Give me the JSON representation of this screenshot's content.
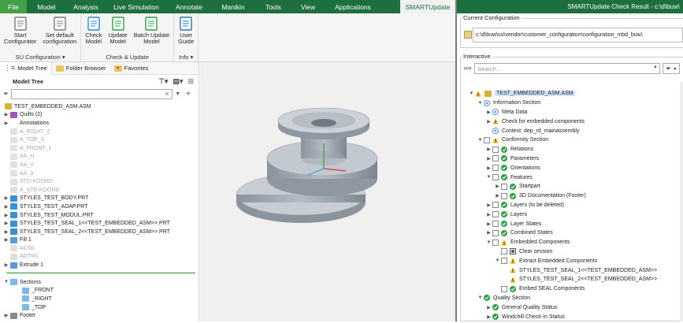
{
  "menubar": {
    "tabs": [
      "File",
      "Model",
      "Analysis",
      "Live Simulation",
      "Annotate",
      "Manikin",
      "Tools",
      "View",
      "Applications",
      "SMARTUpdate"
    ]
  },
  "ribbon": {
    "groups": [
      {
        "name": "SU Configuration ▾",
        "buttons": [
          "Start\nConfigurator",
          "Set default\nconfiguration"
        ]
      },
      {
        "name": "Check & Update",
        "buttons": [
          "Check\nModel",
          "Update\nModel",
          "Batch Update\nModel"
        ]
      },
      {
        "name": "Info ▾",
        "buttons": [
          "User\nGuide"
        ]
      }
    ]
  },
  "navtabs": [
    "Model Tree",
    "Folder Browser",
    "Favorites"
  ],
  "model_tree": {
    "header": "Model Tree",
    "items": [
      {
        "label": "TEST_EMBEDDED_ASM.ASM",
        "indent": 0,
        "arrow": "",
        "icon": "asm",
        "grey": false
      },
      {
        "label": "Quilts (2)",
        "indent": 1,
        "arrow": "▶",
        "icon": "quilt",
        "grey": false
      },
      {
        "label": "Annotations",
        "indent": 1,
        "arrow": "▶",
        "icon": "none",
        "grey": false
      },
      {
        "label": "A_RIGHT_2",
        "indent": 1,
        "arrow": "",
        "icon": "plane",
        "grey": true
      },
      {
        "label": "A_TOP_3",
        "indent": 1,
        "arrow": "",
        "icon": "plane",
        "grey": true
      },
      {
        "label": "A_FRONT_1",
        "indent": 1,
        "arrow": "",
        "icon": "plane",
        "grey": true
      },
      {
        "label": "AA_H",
        "indent": 1,
        "arrow": "",
        "icon": "axis",
        "grey": true
      },
      {
        "label": "AA_V",
        "indent": 1,
        "arrow": "",
        "icon": "axis",
        "grey": true
      },
      {
        "label": "AA_3",
        "indent": 1,
        "arrow": "",
        "icon": "axis",
        "grey": true
      },
      {
        "label": "STD-KOORD",
        "indent": 1,
        "arrow": "",
        "icon": "csys",
        "grey": true
      },
      {
        "label": "A_STD-KOORD",
        "indent": 1,
        "arrow": "",
        "icon": "csys",
        "grey": true
      },
      {
        "label": "STYLES_TEST_BODY.PRT",
        "indent": 1,
        "arrow": "▶",
        "icon": "part",
        "grey": false
      },
      {
        "label": "STYLES_TEST_ADAP.PRT",
        "indent": 1,
        "arrow": "▶",
        "icon": "part",
        "grey": false
      },
      {
        "label": "STYLES_TEST_MODUL.PRT",
        "indent": 1,
        "arrow": "▶",
        "icon": "part",
        "grey": false
      },
      {
        "label": "STYLES_TEST_SEAL_1<<TEST_EMBEDDED_ASM>>.PRT",
        "indent": 1,
        "arrow": "▶",
        "icon": "part",
        "grey": false
      },
      {
        "label": "STYLES_TEST_SEAL_2<<TEST_EMBEDDED_ASM>>.PRT",
        "indent": 1,
        "arrow": "▶",
        "icon": "part",
        "grey": false
      },
      {
        "label": "Fill 1",
        "indent": 1,
        "arrow": "▶",
        "icon": "fill",
        "grey": false
      },
      {
        "label": "ACS0",
        "indent": 1,
        "arrow": "",
        "icon": "csys",
        "grey": true
      },
      {
        "label": "ADTM1",
        "indent": 1,
        "arrow": "",
        "icon": "plane",
        "grey": true
      },
      {
        "label": "Extrude 1",
        "indent": 1,
        "arrow": "▶",
        "icon": "extrude",
        "grey": false
      }
    ],
    "section_items": [
      {
        "label": "Sections",
        "indent": 1,
        "arrow": "▼",
        "icon": "section",
        "grey": false
      },
      {
        "label": "_FRONT",
        "indent": 2,
        "arrow": "",
        "icon": "section",
        "grey": false
      },
      {
        "label": "_RIGHT",
        "indent": 2,
        "arrow": "",
        "icon": "section",
        "grey": false
      },
      {
        "label": "_TOP",
        "indent": 2,
        "arrow": "",
        "icon": "section",
        "grey": false
      },
      {
        "label": "Footer",
        "indent": 1,
        "arrow": "▶",
        "icon": "footer",
        "grey": false
      }
    ]
  },
  "right_panel": {
    "title": "SMARTUpdate Check Result - c:\\d\\buw\\",
    "current_config_label": "Current Configuration",
    "config_path": "c:\\d\\buw\\su\\vendor\\customer_configuration\\configuration_mbd_buw\\",
    "interactive_label": "Interactive",
    "search_placeholder": "Search...",
    "items": [
      {
        "label": "TEST_EMBEDDED_ASM.ASM",
        "indent": 0,
        "arrow": "▼",
        "cb": false,
        "status": "warn",
        "extra": "asm",
        "selected": true
      },
      {
        "label": "Information Section",
        "indent": 1,
        "arrow": "▼",
        "cb": false,
        "status": "info",
        "extra": "",
        "selected": false
      },
      {
        "label": "Meta Data",
        "indent": 2,
        "arrow": "▶",
        "cb": false,
        "status": "info",
        "extra": "",
        "selected": false
      },
      {
        "label": "Check for embedded components",
        "indent": 2,
        "arrow": "▶",
        "cb": false,
        "status": "warn",
        "extra": "",
        "selected": false
      },
      {
        "label": "Context:  dep_rd_mainassembly",
        "indent": 2,
        "arrow": "",
        "cb": false,
        "status": "info",
        "extra": "",
        "selected": false
      },
      {
        "label": "Conformity Section",
        "indent": 1,
        "arrow": "▼",
        "cb": true,
        "status": "warn",
        "extra": "",
        "selected": false
      },
      {
        "label": "Relations",
        "indent": 2,
        "arrow": "▶",
        "cb": true,
        "status": "ok",
        "extra": "",
        "selected": false
      },
      {
        "label": "Parameters",
        "indent": 2,
        "arrow": "▶",
        "cb": true,
        "status": "ok",
        "extra": "",
        "selected": false
      },
      {
        "label": "Orientations",
        "indent": 2,
        "arrow": "▶",
        "cb": true,
        "status": "ok",
        "extra": "",
        "selected": false
      },
      {
        "label": "Features",
        "indent": 2,
        "arrow": "▼",
        "cb": true,
        "status": "ok",
        "extra": "",
        "selected": false
      },
      {
        "label": "Startpart",
        "indent": 3,
        "arrow": "▶",
        "cb": true,
        "status": "ok",
        "extra": "",
        "selected": false
      },
      {
        "label": "3D Documentation (Footer)",
        "indent": 3,
        "arrow": "▶",
        "cb": true,
        "status": "ok",
        "extra": "",
        "selected": false
      },
      {
        "label": "Layers (to be deleted)",
        "indent": 2,
        "arrow": "▶",
        "cb": true,
        "status": "ok",
        "extra": "",
        "selected": false
      },
      {
        "label": "Layers",
        "indent": 2,
        "arrow": "▶",
        "cb": true,
        "status": "ok",
        "extra": "",
        "selected": false
      },
      {
        "label": "Layer States",
        "indent": 2,
        "arrow": "▶",
        "cb": true,
        "status": "ok",
        "extra": "",
        "selected": false
      },
      {
        "label": "Combined States",
        "indent": 2,
        "arrow": "▶",
        "cb": true,
        "status": "ok",
        "extra": "",
        "selected": false
      },
      {
        "label": "Embedded Components",
        "indent": 2,
        "arrow": "▼",
        "cb": true,
        "status": "warn",
        "extra": "",
        "selected": false
      },
      {
        "label": "Clear session",
        "indent": 3,
        "arrow": "",
        "cb": true,
        "status": "gear",
        "extra": "",
        "selected": false
      },
      {
        "label": "Extract Embedded Components",
        "indent": 3,
        "arrow": "▼",
        "cb": true,
        "status": "warn",
        "extra": "",
        "selected": false
      },
      {
        "label": "STYLES_TEST_SEAL_1<<TEST_EMBEDDED_ASM>>",
        "indent": 4,
        "arrow": "",
        "cb": false,
        "status": "warn",
        "extra": "",
        "selected": false
      },
      {
        "label": "STYLES_TEST_SEAL_2<<TEST_EMBEDDED_ASM>>",
        "indent": 4,
        "arrow": "",
        "cb": false,
        "status": "warn",
        "extra": "",
        "selected": false
      },
      {
        "label": "Embed SEAL Components",
        "indent": 3,
        "arrow": "",
        "cb": true,
        "status": "ok",
        "extra": "",
        "selected": false
      },
      {
        "label": "Quality Section",
        "indent": 1,
        "arrow": "▼",
        "cb": false,
        "status": "ok",
        "extra": "",
        "selected": false
      },
      {
        "label": "General Quality Status",
        "indent": 2,
        "arrow": "▶",
        "cb": false,
        "status": "ok",
        "extra": "",
        "selected": false
      },
      {
        "label": "Windchill Check-In Status",
        "indent": 2,
        "arrow": "▶",
        "cb": false,
        "status": "ok",
        "extra": "",
        "selected": false
      }
    ]
  },
  "colors": {
    "brand_green": "#1e6f3e",
    "ok_green": "#2ea043",
    "warn_yellow": "#f2b705",
    "info_blue": "#5b8fd6"
  }
}
